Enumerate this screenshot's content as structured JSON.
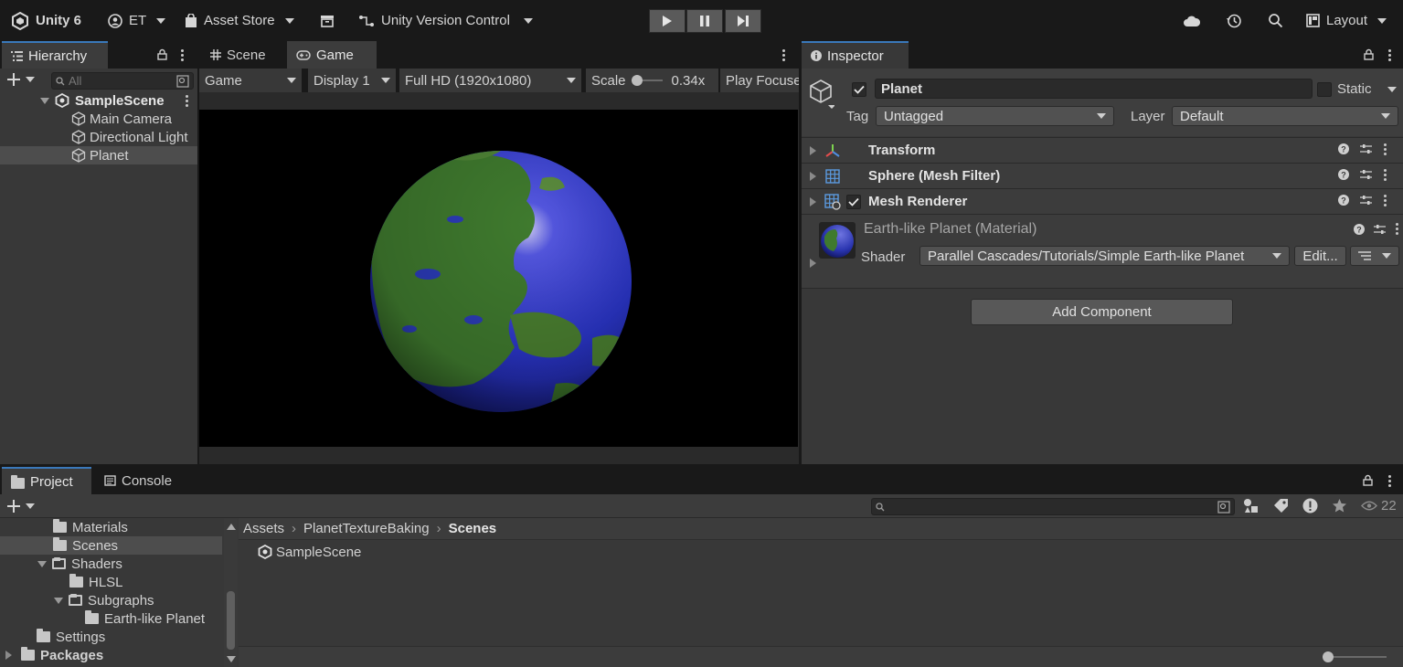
{
  "toolbar": {
    "app_name": "Unity 6",
    "account": "ET",
    "asset_store": "Asset Store",
    "version_control": "Unity Version Control",
    "layout": "Layout"
  },
  "hierarchy": {
    "tab_label": "Hierarchy",
    "search_placeholder": "All",
    "scene": "SampleScene",
    "items": [
      "Main Camera",
      "Directional Light",
      "Planet"
    ],
    "selected": "Planet"
  },
  "center": {
    "tabs": [
      "Scene",
      "Game"
    ],
    "active_tab": "Game",
    "game_mode": "Game",
    "display": "Display 1",
    "resolution": "Full HD (1920x1080)",
    "scale_label": "Scale",
    "scale_value": "0.34x",
    "play_focus": "Play Focuse"
  },
  "inspector": {
    "tab_label": "Inspector",
    "object_name": "Planet",
    "static_label": "Static",
    "tag_label": "Tag",
    "tag_value": "Untagged",
    "layer_label": "Layer",
    "layer_value": "Default",
    "components": [
      "Transform",
      "Sphere (Mesh Filter)",
      "Mesh Renderer"
    ],
    "material_name": "Earth-like Planet (Material)",
    "shader_label": "Shader",
    "shader_value": "Parallel Cascades/Tutorials/Simple Earth-like  Planet",
    "edit_button": "Edit...",
    "add_component": "Add Component"
  },
  "project": {
    "tabs": [
      "Project",
      "Console"
    ],
    "tree": [
      {
        "label": "Materials",
        "depth": 2
      },
      {
        "label": "Scenes",
        "depth": 2,
        "selected": true
      },
      {
        "label": "Shaders",
        "depth": 2,
        "expanded": true
      },
      {
        "label": "HLSL",
        "depth": 3
      },
      {
        "label": "Subgraphs",
        "depth": 3,
        "expanded": true
      },
      {
        "label": "Earth-like Planet",
        "depth": 4
      },
      {
        "label": "Settings",
        "depth": 1
      },
      {
        "label": "Packages",
        "depth": 0,
        "bold": true
      }
    ],
    "breadcrumb": [
      "Assets",
      "PlanetTextureBaking",
      "Scenes"
    ],
    "assets": [
      "SampleScene"
    ],
    "hidden_count": "22"
  },
  "colors": {
    "accent": "#3a79bb",
    "panel": "#383838",
    "toolbar": "#191919",
    "ocean": "#2a35c8",
    "land": "#3f7a2e"
  },
  "icons": [
    "unity-logo-icon",
    "account-icon",
    "bag-icon",
    "archive-icon",
    "branch-icon",
    "play-icon",
    "pause-icon",
    "step-icon",
    "cloud-icon",
    "history-icon",
    "search-icon",
    "layout-icon"
  ]
}
